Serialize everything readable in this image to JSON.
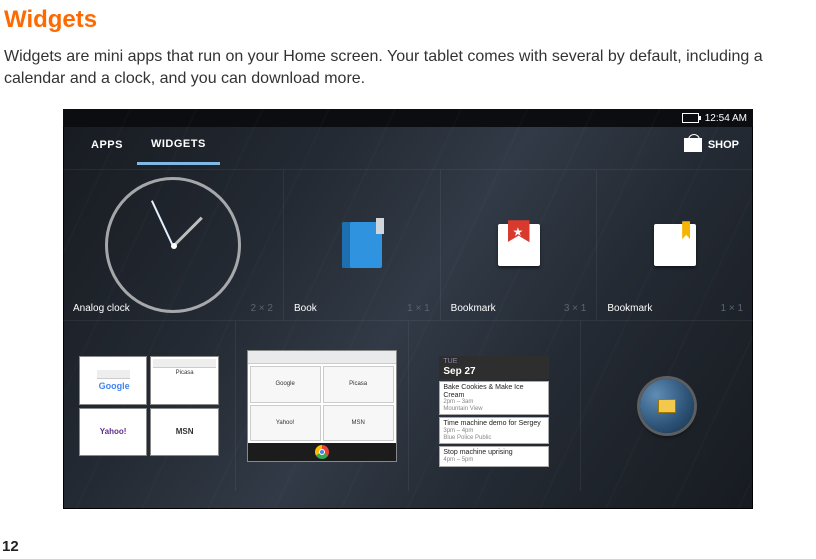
{
  "doc": {
    "title": "Widgets",
    "intro": "Widgets are mini apps that run on your Home screen. Your tablet comes with several by default, including a calendar and a clock, and you can download more.",
    "page_number": "12"
  },
  "tablet": {
    "status_time": "12:54 AM",
    "tabs": {
      "apps": "APPS",
      "widgets": "WIDGETS"
    },
    "shop_label": "SHOP",
    "widgets_row1": [
      {
        "name": "Analog clock",
        "dim": "2 × 2"
      },
      {
        "name": "Book",
        "dim": "1 × 1"
      },
      {
        "name": "Bookmark",
        "dim": "3 × 1"
      },
      {
        "name": "Bookmark",
        "dim": "1 × 1"
      }
    ],
    "browser_tiles": [
      "Google",
      "Picasa",
      "Yahoo!",
      "MSN"
    ],
    "calendar": {
      "dow": "TUE",
      "date": "Sep 27",
      "events": [
        {
          "title": "Bake Cookies & Make Ice Cream",
          "time": "2pm – 3am",
          "where": "Mountain View"
        },
        {
          "title": "Time machine demo for Sergey",
          "time": "3pm – 4pm",
          "where": "Blue Police Public"
        },
        {
          "title": "Stop machine uprising",
          "time": "4pm – 5pm",
          "where": ""
        }
      ]
    }
  }
}
